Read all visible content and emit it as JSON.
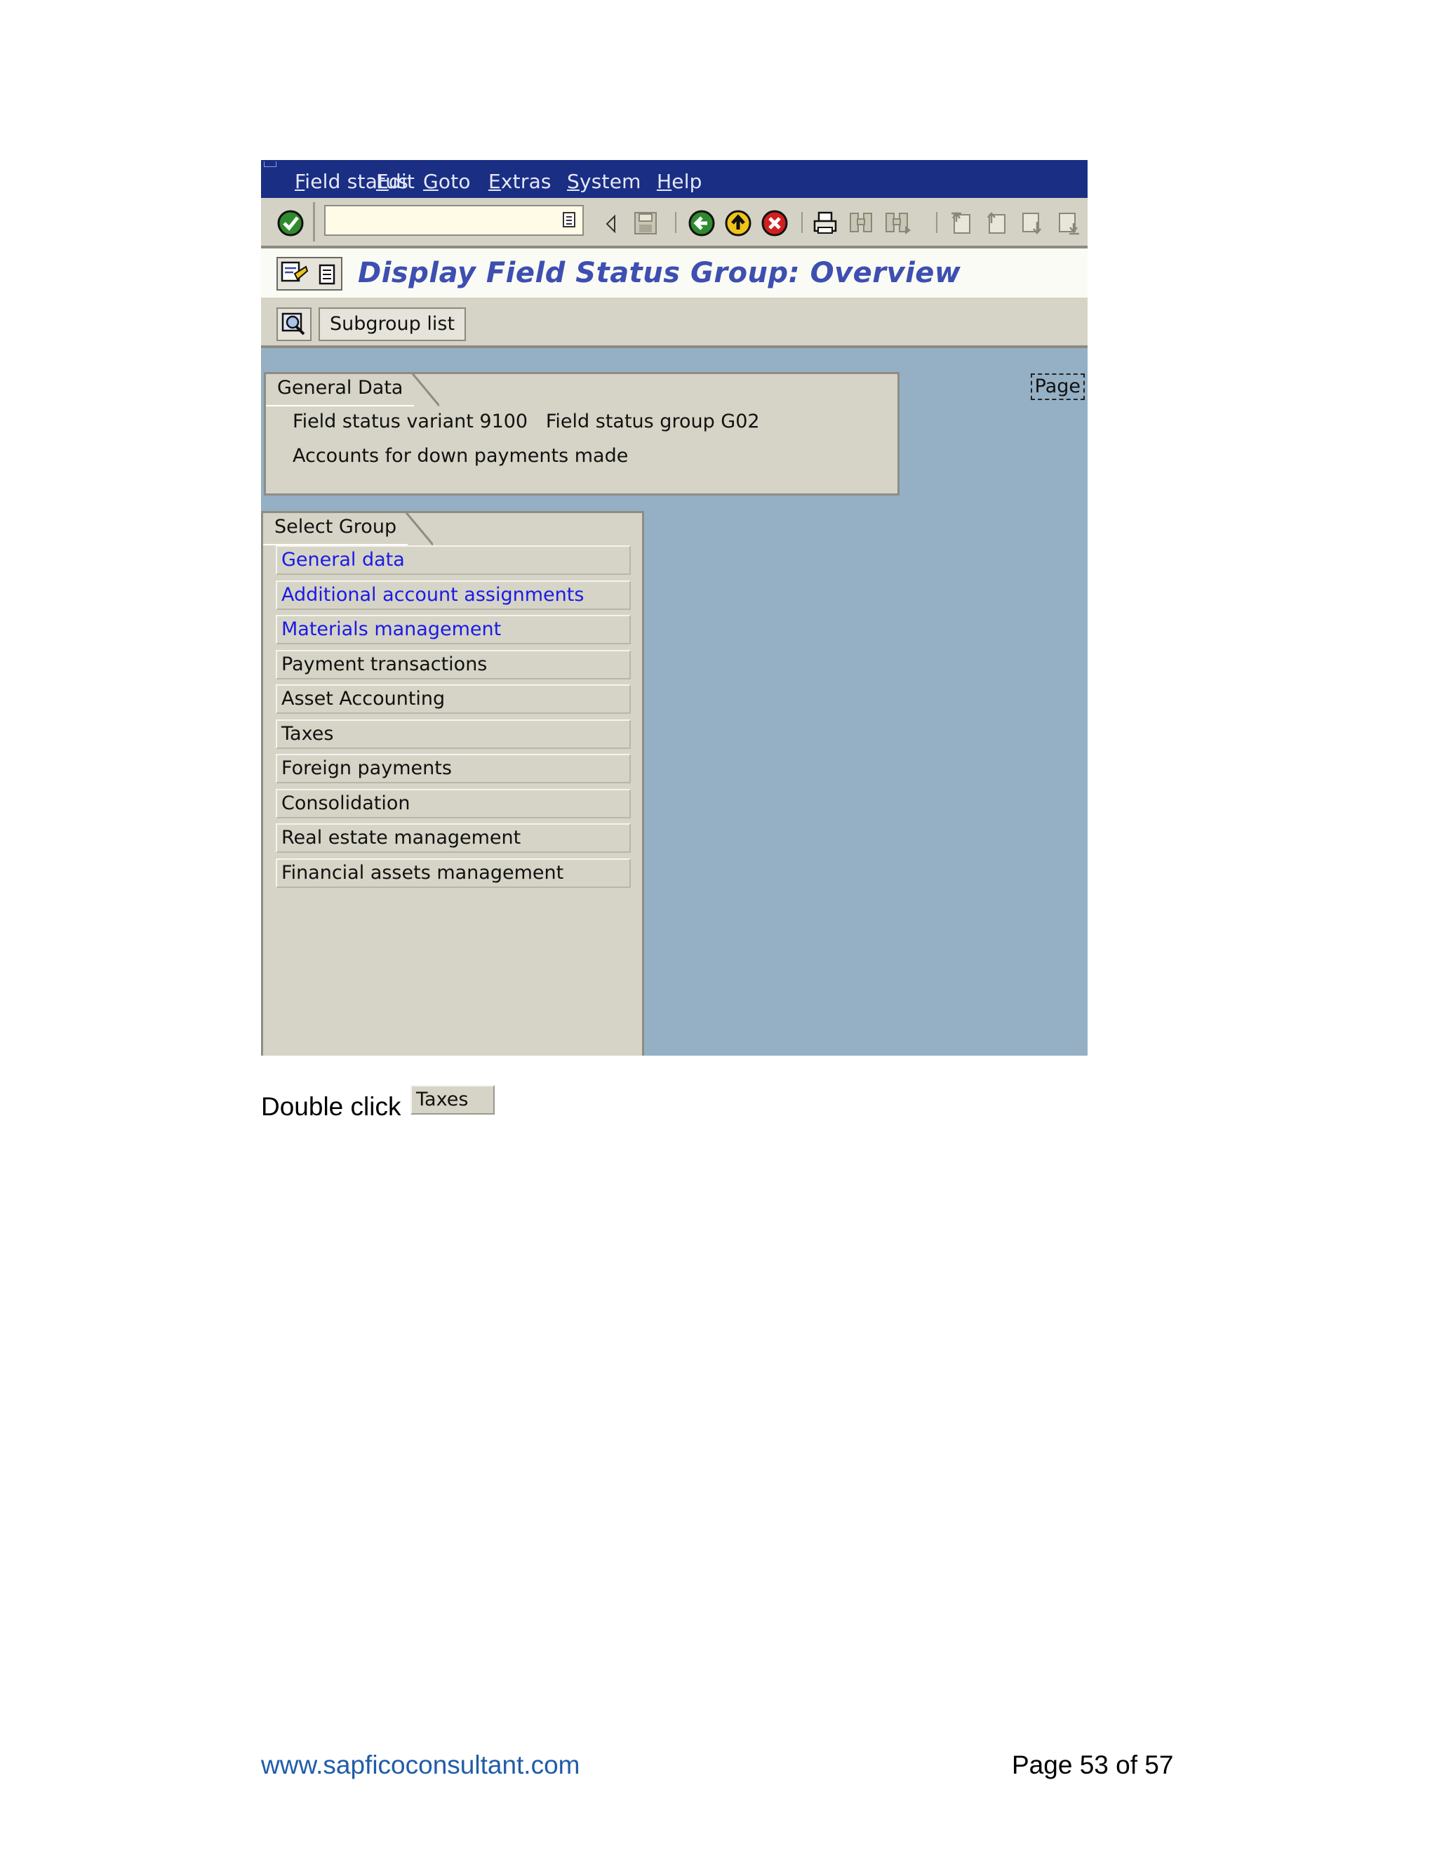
{
  "window": {
    "menu": [
      "Field status",
      "Edit",
      "Goto",
      "Extras",
      "System",
      "Help"
    ],
    "command_field": {
      "value": ""
    },
    "title": "Display Field Status Group: Overview",
    "app_toolbar": {
      "subgroup_list": "Subgroup list"
    },
    "page_button": "Page",
    "general_data": {
      "tab": "General Data",
      "line1": "Field status variant 9100   Field status group G02",
      "line2": "Accounts for down payments made"
    },
    "select_group": {
      "tab": "Select Group",
      "items": [
        {
          "label": "General data",
          "highlight": true
        },
        {
          "label": "Additional account assignments",
          "highlight": true
        },
        {
          "label": "Materials management",
          "highlight": true
        },
        {
          "label": "Payment transactions",
          "highlight": false
        },
        {
          "label": "Asset Accounting",
          "highlight": false
        },
        {
          "label": "Taxes",
          "highlight": false
        },
        {
          "label": "Foreign payments",
          "highlight": false
        },
        {
          "label": "Consolidation",
          "highlight": false
        },
        {
          "label": "Real estate management",
          "highlight": false
        },
        {
          "label": "Financial assets management",
          "highlight": false
        }
      ]
    },
    "colors": {
      "menubar": "#1a2e84",
      "title": "#3d4fb0",
      "highlight_link": "#1a1ae8",
      "screen_bg": "#95b0c4",
      "panel": "#d6d4c6"
    }
  },
  "instruction": {
    "text": "Double click",
    "button": "Taxes"
  },
  "footer": {
    "website": "www.sapficoconsultant.com",
    "page": "Page 53 of 57"
  }
}
